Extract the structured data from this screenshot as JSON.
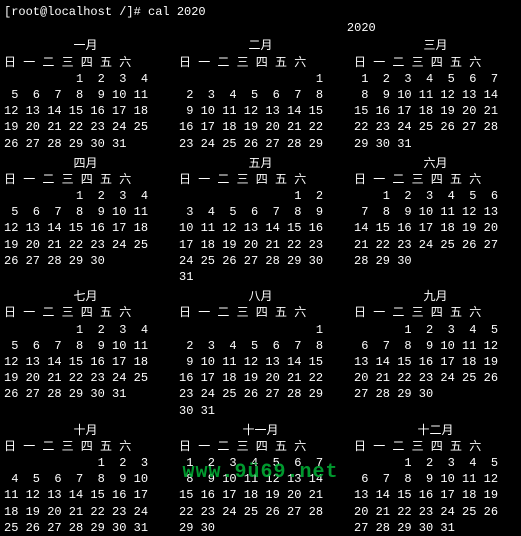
{
  "prompt": "[root@localhost /]# cal 2020",
  "year_label": "                            2020",
  "watermark": "www.9ü69.net",
  "day_header": "日 一 二 三 四 五 六",
  "months": [
    {
      "name": "一月",
      "weeks": [
        [
          null,
          null,
          null,
          1,
          2,
          3,
          4
        ],
        [
          5,
          6,
          7,
          8,
          9,
          10,
          11
        ],
        [
          12,
          13,
          14,
          15,
          16,
          17,
          18
        ],
        [
          19,
          20,
          21,
          22,
          23,
          24,
          25
        ],
        [
          26,
          27,
          28,
          29,
          30,
          31,
          null
        ],
        [
          null,
          null,
          null,
          null,
          null,
          null,
          null
        ]
      ]
    },
    {
      "name": "二月",
      "weeks": [
        [
          null,
          null,
          null,
          null,
          null,
          null,
          1
        ],
        [
          2,
          3,
          4,
          5,
          6,
          7,
          8
        ],
        [
          9,
          10,
          11,
          12,
          13,
          14,
          15
        ],
        [
          16,
          17,
          18,
          19,
          20,
          21,
          22
        ],
        [
          23,
          24,
          25,
          26,
          27,
          28,
          29
        ],
        [
          null,
          null,
          null,
          null,
          null,
          null,
          null
        ]
      ]
    },
    {
      "name": "三月",
      "weeks": [
        [
          1,
          2,
          3,
          4,
          5,
          6,
          7
        ],
        [
          8,
          9,
          10,
          11,
          12,
          13,
          14
        ],
        [
          15,
          16,
          17,
          18,
          19,
          20,
          21
        ],
        [
          22,
          23,
          24,
          25,
          26,
          27,
          28
        ],
        [
          29,
          30,
          31,
          null,
          null,
          null,
          null
        ],
        [
          null,
          null,
          null,
          null,
          null,
          null,
          null
        ]
      ]
    },
    {
      "name": "四月",
      "weeks": [
        [
          null,
          null,
          null,
          1,
          2,
          3,
          4
        ],
        [
          5,
          6,
          7,
          8,
          9,
          10,
          11
        ],
        [
          12,
          13,
          14,
          15,
          16,
          17,
          18
        ],
        [
          19,
          20,
          21,
          22,
          23,
          24,
          25
        ],
        [
          26,
          27,
          28,
          29,
          30,
          null,
          null
        ],
        [
          null,
          null,
          null,
          null,
          null,
          null,
          null
        ]
      ]
    },
    {
      "name": "五月",
      "weeks": [
        [
          null,
          null,
          null,
          null,
          null,
          1,
          2
        ],
        [
          3,
          4,
          5,
          6,
          7,
          8,
          9
        ],
        [
          10,
          11,
          12,
          13,
          14,
          15,
          16
        ],
        [
          17,
          18,
          19,
          20,
          21,
          22,
          23
        ],
        [
          24,
          25,
          26,
          27,
          28,
          29,
          30
        ],
        [
          31,
          null,
          null,
          null,
          null,
          null,
          null
        ]
      ]
    },
    {
      "name": "六月",
      "weeks": [
        [
          null,
          1,
          2,
          3,
          4,
          5,
          6
        ],
        [
          7,
          8,
          9,
          10,
          11,
          12,
          13
        ],
        [
          14,
          15,
          16,
          17,
          18,
          19,
          20
        ],
        [
          21,
          22,
          23,
          24,
          25,
          26,
          27
        ],
        [
          28,
          29,
          30,
          null,
          null,
          null,
          null
        ],
        [
          null,
          null,
          null,
          null,
          null,
          null,
          null
        ]
      ]
    },
    {
      "name": "七月",
      "weeks": [
        [
          null,
          null,
          null,
          1,
          2,
          3,
          4
        ],
        [
          5,
          6,
          7,
          8,
          9,
          10,
          11
        ],
        [
          12,
          13,
          14,
          15,
          16,
          17,
          18
        ],
        [
          19,
          20,
          21,
          22,
          23,
          24,
          25
        ],
        [
          26,
          27,
          28,
          29,
          30,
          31,
          null
        ],
        [
          null,
          null,
          null,
          null,
          null,
          null,
          null
        ]
      ]
    },
    {
      "name": "八月",
      "weeks": [
        [
          null,
          null,
          null,
          null,
          null,
          null,
          1
        ],
        [
          2,
          3,
          4,
          5,
          6,
          7,
          8
        ],
        [
          9,
          10,
          11,
          12,
          13,
          14,
          15
        ],
        [
          16,
          17,
          18,
          19,
          20,
          21,
          22
        ],
        [
          23,
          24,
          25,
          26,
          27,
          28,
          29
        ],
        [
          30,
          31,
          null,
          null,
          null,
          null,
          null
        ]
      ]
    },
    {
      "name": "九月",
      "weeks": [
        [
          null,
          null,
          1,
          2,
          3,
          4,
          5
        ],
        [
          6,
          7,
          8,
          9,
          10,
          11,
          12
        ],
        [
          13,
          14,
          15,
          16,
          17,
          18,
          19
        ],
        [
          20,
          21,
          22,
          23,
          24,
          25,
          26
        ],
        [
          27,
          28,
          29,
          30,
          null,
          null,
          null
        ],
        [
          null,
          null,
          null,
          null,
          null,
          null,
          null
        ]
      ]
    },
    {
      "name": "十月",
      "weeks": [
        [
          null,
          null,
          null,
          null,
          1,
          2,
          3
        ],
        [
          4,
          5,
          6,
          7,
          8,
          9,
          10
        ],
        [
          11,
          12,
          13,
          14,
          15,
          16,
          17
        ],
        [
          18,
          19,
          20,
          21,
          22,
          23,
          24
        ],
        [
          25,
          26,
          27,
          28,
          29,
          30,
          31
        ],
        [
          null,
          null,
          null,
          null,
          null,
          null,
          null
        ]
      ]
    },
    {
      "name": "十一月",
      "weeks": [
        [
          1,
          2,
          3,
          4,
          5,
          6,
          7
        ],
        [
          8,
          9,
          10,
          11,
          12,
          13,
          14
        ],
        [
          15,
          16,
          17,
          18,
          19,
          20,
          21
        ],
        [
          22,
          23,
          24,
          25,
          26,
          27,
          28
        ],
        [
          29,
          30,
          null,
          null,
          null,
          null,
          null
        ],
        [
          null,
          null,
          null,
          null,
          null,
          null,
          null
        ]
      ]
    },
    {
      "name": "十二月",
      "weeks": [
        [
          null,
          null,
          1,
          2,
          3,
          4,
          5
        ],
        [
          6,
          7,
          8,
          9,
          10,
          11,
          12
        ],
        [
          13,
          14,
          15,
          16,
          17,
          18,
          19
        ],
        [
          20,
          21,
          22,
          23,
          24,
          25,
          26
        ],
        [
          27,
          28,
          29,
          30,
          31,
          null,
          null
        ],
        [
          null,
          null,
          null,
          null,
          null,
          null,
          null
        ]
      ]
    }
  ]
}
